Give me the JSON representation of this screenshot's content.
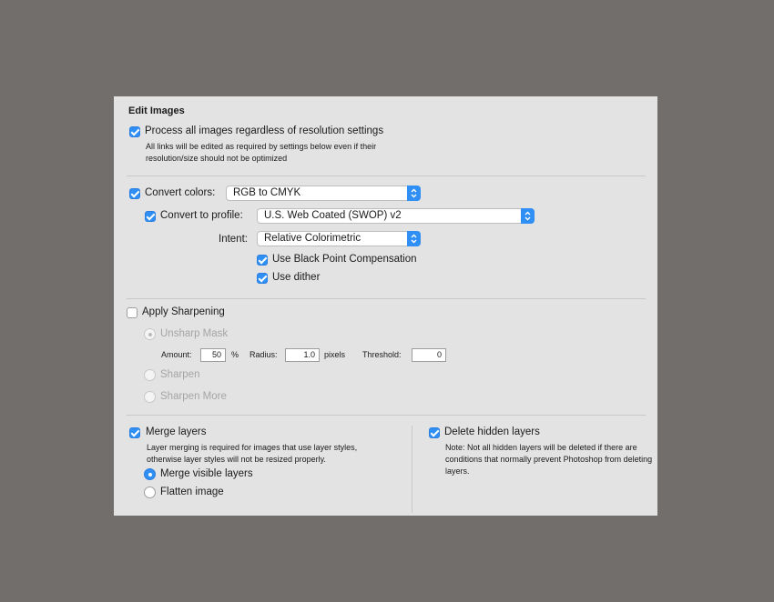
{
  "dialog": {
    "title": "Edit Images",
    "process_all": {
      "label": "Process all images regardless of resolution settings",
      "checked": true,
      "note": "All links will be edited as required by settings below even if their resolution/size should not be optimized"
    },
    "convert_colors": {
      "label": "Convert colors:",
      "checked": true,
      "value": "RGB to CMYK"
    },
    "convert_profile": {
      "label": "Convert to profile:",
      "checked": true,
      "value": "U.S. Web Coated (SWOP) v2"
    },
    "intent": {
      "label": "Intent:",
      "value": "Relative Colorimetric"
    },
    "black_point": {
      "label": "Use Black Point Compensation",
      "checked": true
    },
    "dither": {
      "label": "Use dither",
      "checked": true
    },
    "sharpening": {
      "label": "Apply Sharpening",
      "checked": false,
      "unsharp": {
        "label": "Unsharp Mask",
        "selected": true,
        "enabled": false
      },
      "amount_label": "Amount:",
      "amount_value": "50",
      "amount_unit": "%",
      "radius_label": "Radius:",
      "radius_value": "1.0",
      "radius_unit": "pixels",
      "threshold_label": "Threshold:",
      "threshold_value": "0",
      "sharpen": {
        "label": "Sharpen",
        "selected": false,
        "enabled": false
      },
      "sharpen_more": {
        "label": "Sharpen More",
        "selected": false,
        "enabled": false
      }
    },
    "merge_layers": {
      "label": "Merge layers",
      "checked": true,
      "note": "Layer merging is required for images that use layer styles, otherwise layer styles will not be resized properly.",
      "merge_visible": {
        "label": "Merge visible layers",
        "selected": true
      },
      "flatten": {
        "label": "Flatten image",
        "selected": false
      }
    },
    "delete_hidden": {
      "label": "Delete hidden layers",
      "checked": true,
      "note": "Note: Not all hidden layers will be deleted if there are conditions that normally prevent Photoshop from deleting layers."
    }
  },
  "colors": {
    "accent": "#2f8ff5",
    "background": "#726e6c",
    "panel": "#e3e3e3"
  }
}
